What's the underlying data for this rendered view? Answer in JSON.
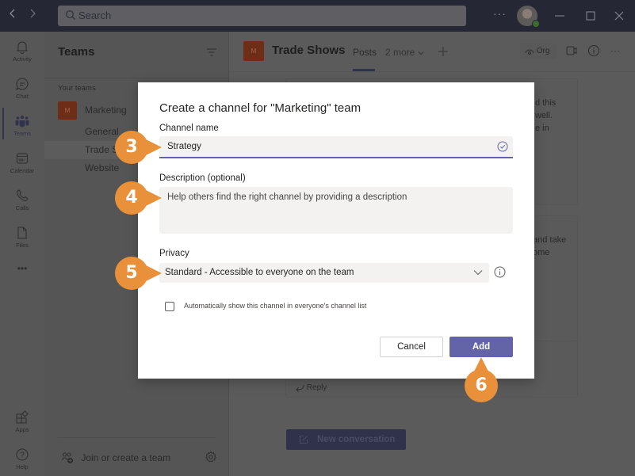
{
  "titlebar": {
    "search_placeholder": "Search",
    "more_label": "···",
    "back_icon": "chevron-left-icon",
    "forward_icon": "chevron-right-icon"
  },
  "rail": {
    "items": [
      {
        "label": "Activity",
        "icon": "bell-icon"
      },
      {
        "label": "Chat",
        "icon": "chat-icon"
      },
      {
        "label": "Teams",
        "icon": "teams-icon",
        "active": true
      },
      {
        "label": "Calendar",
        "icon": "calendar-icon"
      },
      {
        "label": "Calls",
        "icon": "phone-icon"
      },
      {
        "label": "Files",
        "icon": "file-icon"
      }
    ],
    "more_label": "•••",
    "bottom_items": [
      {
        "label": "Apps",
        "icon": "apps-icon"
      },
      {
        "label": "Help",
        "icon": "help-icon"
      }
    ]
  },
  "panel": {
    "title": "Teams",
    "section_label": "Your teams",
    "team": {
      "initial": "M",
      "name": "Marketing"
    },
    "channels": [
      "General",
      "Trade Shows",
      "Website"
    ],
    "selected_channel": "Trade Shows",
    "join_label": "Join or create a team"
  },
  "channel_header": {
    "initial": "M",
    "title": "Trade Shows",
    "tabs": [
      "Posts",
      "2 more"
    ],
    "active_tab": "Posts",
    "org_label": "Org"
  },
  "posts": {
    "fragment_1": [
      "d this",
      "well.",
      "e in"
    ],
    "fragment_2": [
      "and take",
      "ome"
    ],
    "reply_label": "Reply",
    "new_conversation_label": "New conversation"
  },
  "dialog": {
    "title": "Create a channel for \"Marketing\" team",
    "channel_name_label": "Channel name",
    "channel_name_value": "Strategy",
    "description_label": "Description (optional)",
    "description_placeholder": "Help others find the right channel by providing a description",
    "privacy_label": "Privacy",
    "privacy_value": "Standard - Accessible to everyone on the team",
    "auto_show_label": "Automatically show this channel in everyone's channel list",
    "auto_show_checked": false,
    "cancel_label": "Cancel",
    "add_label": "Add"
  },
  "callouts": [
    "3",
    "4",
    "5",
    "6"
  ],
  "colors": {
    "accent": "#6264a7",
    "callout": "#e8913a",
    "titlebar": "#252735"
  }
}
